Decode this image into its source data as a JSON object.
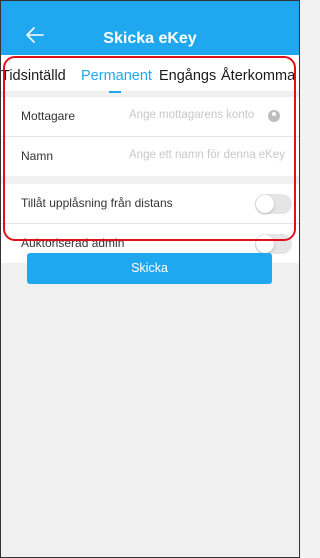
{
  "header": {
    "title": "Skicka eKey",
    "back_icon": "arrow-left-icon",
    "color": "#1fa8ef"
  },
  "tabs": {
    "items": [
      "Tidsintälld",
      "Permanent",
      "Engångs",
      "Återkomma"
    ],
    "active_index": 1
  },
  "form": {
    "recipient": {
      "label": "Mottagare",
      "placeholder": "Ange mottagarens konto",
      "icon": "contact-icon"
    },
    "name": {
      "label": "Namn",
      "placeholder": "Ange ett namn för denna eKey"
    }
  },
  "settings": {
    "remote_unlock": {
      "label": "Tillåt upplåsning från distans",
      "enabled": false
    },
    "authorized_admin": {
      "label": "Auktoriserad admin",
      "enabled": false
    }
  },
  "actions": {
    "send_label": "Skicka"
  },
  "annotation": {
    "color": "#e0101a"
  }
}
